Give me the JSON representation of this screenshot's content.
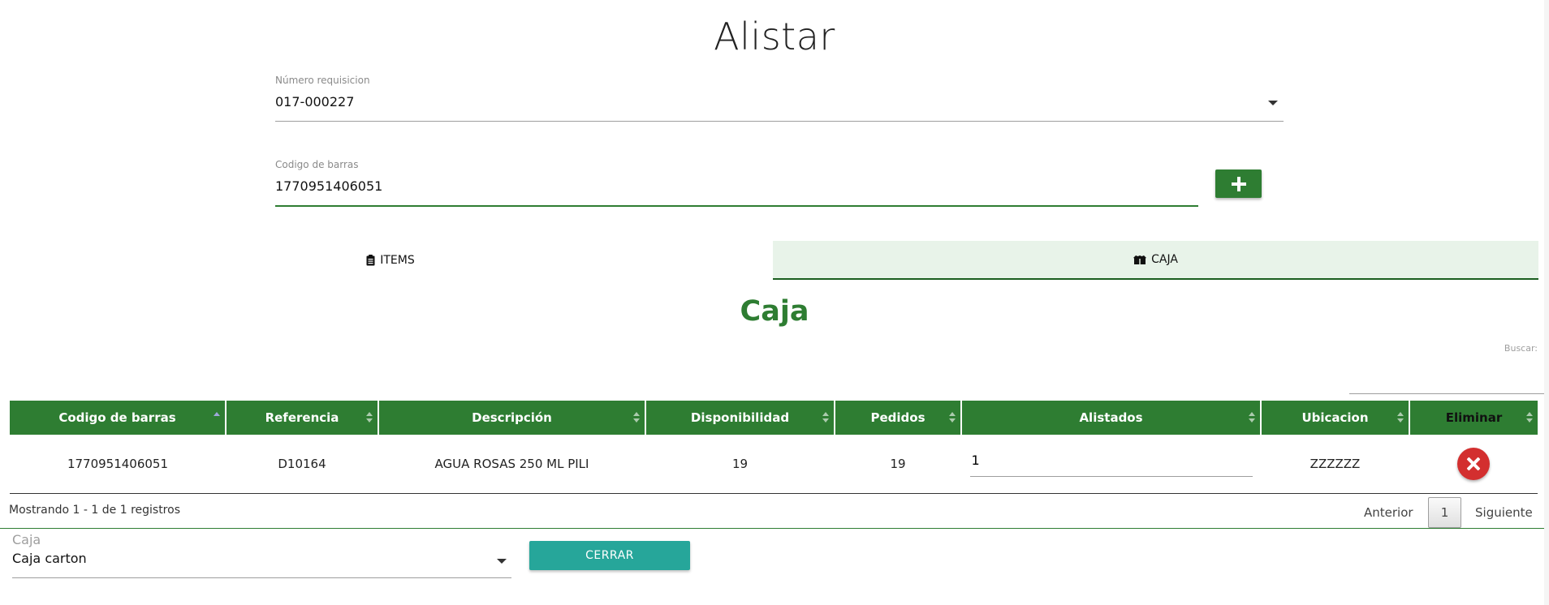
{
  "page": {
    "title": "Alistar"
  },
  "requisicion": {
    "label": "Número requisicion",
    "value": "017-000227"
  },
  "barcode": {
    "label": "Codigo de barras",
    "value": "1770951406051"
  },
  "tabs": [
    {
      "label": "ITEMS",
      "icon": "clipboard-icon",
      "active": false
    },
    {
      "label": "CAJA",
      "icon": "box-icon",
      "active": true
    }
  ],
  "section": {
    "title": "Caja"
  },
  "search": {
    "label": "Buscar:",
    "value": ""
  },
  "table": {
    "headers": [
      "Codigo de barras",
      "Referencia",
      "Descripción",
      "Disponibilidad",
      "Pedidos",
      "Alistados",
      "Ubicacion",
      "Eliminar"
    ],
    "rows": [
      {
        "codigo": "1770951406051",
        "referencia": "D10164",
        "descripcion": "AGUA ROSAS 250 ML PILI",
        "disponibilidad": "19",
        "pedidos": "19",
        "alistados": "1",
        "ubicacion": "ZZZZZZ"
      }
    ]
  },
  "info": "Mostrando 1 - 1 de 1 registros",
  "pagination": {
    "prev": "Anterior",
    "current": "1",
    "next": "Siguiente"
  },
  "caja": {
    "label": "Caja",
    "value": "Caja carton"
  },
  "cerrar": {
    "label": "CERRAR"
  },
  "colors": {
    "primary": "#2e7d32",
    "active_tab_bg": "#e8f3e9",
    "delete": "#d32f2f",
    "cerrar": "#26a69a"
  }
}
